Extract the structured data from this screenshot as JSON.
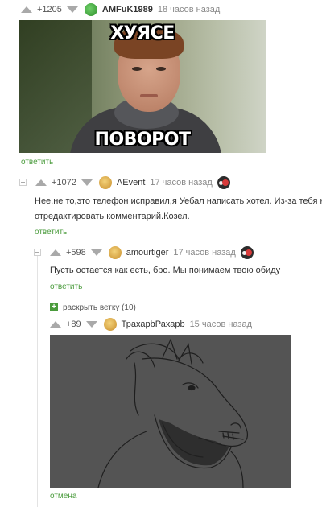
{
  "comments": [
    {
      "rating": "+1205",
      "nick": "AMFuK1989",
      "time": "18 часов назад",
      "image": {
        "caption_top": "ХУЯСЕ",
        "caption_bottom": "ПОВОРОТ"
      },
      "reply_label": "ответить"
    },
    {
      "rating": "+1072",
      "nick": "AEvent",
      "time": "17 часов назад",
      "text_line1": "Нее,не то,это телефон исправил,я Уебал написать хотел. Из-за тебя не м",
      "text_line2": "отредактировать комментарий.Козел.",
      "reply_label": "ответить"
    },
    {
      "rating": "+598",
      "nick": "amourtiger",
      "time": "17 часов назад",
      "text_line1": "Пусть остается как есть, бро. Мы понимаем твою обиду",
      "reply_label": "ответить"
    },
    {
      "rating": "+89",
      "nick": "ТрахарbРахарb",
      "time": "15 часов назад",
      "reply_label": "отмена"
    }
  ],
  "expand_thread": {
    "icon": "+",
    "label": "раскрыть ветку (10)"
  },
  "colors": {
    "accent_green": "#4a9b3c",
    "arrow_gray": "#a9a9a9"
  }
}
